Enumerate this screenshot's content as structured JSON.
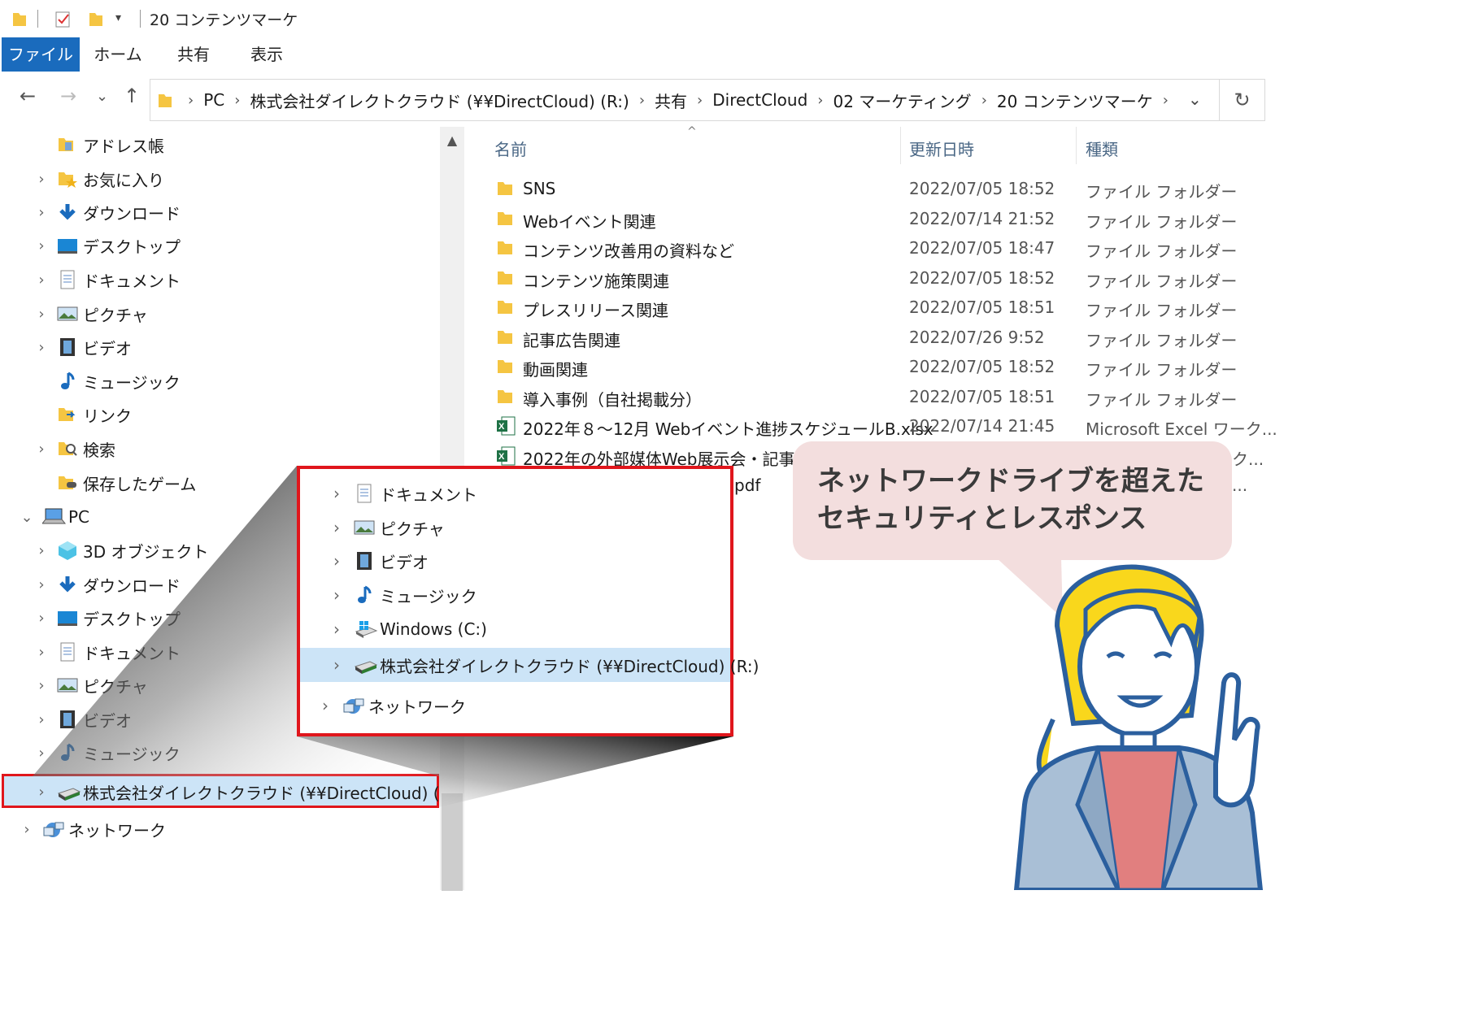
{
  "window": {
    "title": "20 コンテンツマーケ"
  },
  "ribbon": {
    "tabs": [
      {
        "label": "ファイル"
      },
      {
        "label": "ホーム"
      },
      {
        "label": "共有"
      },
      {
        "label": "表示"
      }
    ]
  },
  "address": {
    "crumbs": [
      "PC",
      "株式会社ダイレクトクラウド (¥¥DirectCloud) (R:)",
      "共有",
      "DirectCloud",
      "02 マーケティング",
      "20 コンテンツマーケ"
    ],
    "sep": "›"
  },
  "nav": {
    "items": [
      {
        "label": "アドレス帳",
        "icon": "contacts-folder-icon",
        "chev": ""
      },
      {
        "label": "お気に入り",
        "icon": "favorites-folder-icon",
        "chev": "›"
      },
      {
        "label": "ダウンロード",
        "icon": "download-icon",
        "chev": "›"
      },
      {
        "label": "デスクトップ",
        "icon": "desktop-icon",
        "chev": "›"
      },
      {
        "label": "ドキュメント",
        "icon": "document-icon",
        "chev": "›"
      },
      {
        "label": "ピクチャ",
        "icon": "picture-icon",
        "chev": "›"
      },
      {
        "label": "ビデオ",
        "icon": "video-icon",
        "chev": "›"
      },
      {
        "label": "ミュージック",
        "icon": "music-icon",
        "chev": ""
      },
      {
        "label": "リンク",
        "icon": "links-folder-icon",
        "chev": ""
      },
      {
        "label": "検索",
        "icon": "search-folder-icon",
        "chev": "›"
      },
      {
        "label": "保存したゲーム",
        "icon": "saved-games-icon",
        "chev": ""
      },
      {
        "label": "PC",
        "icon": "pc-icon",
        "chev": "⌄"
      },
      {
        "label": "3D オブジェクト",
        "icon": "3d-objects-icon",
        "chev": "›"
      },
      {
        "label": "ダウンロード",
        "icon": "download-icon",
        "chev": "›"
      },
      {
        "label": "デスクトップ",
        "icon": "desktop-icon",
        "chev": "›"
      },
      {
        "label": "ドキュメント",
        "icon": "document-icon",
        "chev": "›"
      },
      {
        "label": "ピクチャ",
        "icon": "picture-icon",
        "chev": "›"
      },
      {
        "label": "ビデオ",
        "icon": "video-icon",
        "chev": "›"
      },
      {
        "label": "ミュージック",
        "icon": "music-icon",
        "chev": "›"
      },
      {
        "label": "株式会社ダイレクトクラウド (¥¥DirectCloud) (R:)",
        "icon": "network-drive-icon",
        "chev": "›"
      },
      {
        "label": "ネットワーク",
        "icon": "network-icon",
        "chev": "›"
      }
    ]
  },
  "files": {
    "headers": {
      "name": "名前",
      "date": "更新日時",
      "type": "種類"
    },
    "rows": [
      {
        "name": "SNS",
        "date": "2022/07/05 18:52",
        "type": "ファイル フォルダー",
        "icon": "folder-icon"
      },
      {
        "name": "Webイベント関連",
        "date": "2022/07/14 21:52",
        "type": "ファイル フォルダー",
        "icon": "folder-icon"
      },
      {
        "name": "コンテンツ改善用の資料など",
        "date": "2022/07/05 18:47",
        "type": "ファイル フォルダー",
        "icon": "folder-icon"
      },
      {
        "name": "コンテンツ施策関連",
        "date": "2022/07/05 18:52",
        "type": "ファイル フォルダー",
        "icon": "folder-icon"
      },
      {
        "name": "プレスリリース関連",
        "date": "2022/07/05 18:51",
        "type": "ファイル フォルダー",
        "icon": "folder-icon"
      },
      {
        "name": "記事広告関連",
        "date": "2022/07/26 9:52",
        "type": "ファイル フォルダー",
        "icon": "folder-icon"
      },
      {
        "name": "動画関連",
        "date": "2022/07/05 18:52",
        "type": "ファイル フォルダー",
        "icon": "folder-icon"
      },
      {
        "name": "導入事例（自社掲載分）",
        "date": "2022/07/05 18:51",
        "type": "ファイル フォルダー",
        "icon": "folder-icon"
      },
      {
        "name": "2022年８～12月 Webイベント進捗スケジュールB.xlsx",
        "date": "2022/07/14 21:45",
        "type": "Microsoft Excel ワーク...",
        "icon": "excel-file-icon"
      },
      {
        "name": "2022年の外部媒体Web展示会・記事広",
        "date": "",
        "type": "ワーク...",
        "icon": "excel-file-icon"
      },
      {
        "name": "pdf",
        "date": "",
        "type": "...",
        "icon": "pdf-file-icon"
      }
    ]
  },
  "zoom": {
    "items": [
      {
        "label": "ドキュメント",
        "icon": "document-icon"
      },
      {
        "label": "ピクチャ",
        "icon": "picture-icon"
      },
      {
        "label": "ビデオ",
        "icon": "video-icon"
      },
      {
        "label": "ミュージック",
        "icon": "music-icon"
      },
      {
        "label": "Windows (C:)",
        "icon": "windows-drive-icon"
      },
      {
        "label": "株式会社ダイレクトクラウド (¥¥DirectCloud) (R:)",
        "icon": "network-drive-icon"
      },
      {
        "label": "ネットワーク",
        "icon": "network-icon"
      }
    ]
  },
  "callout": {
    "text": "ネットワークドライブを超えた\nセキュリティとレスポンス"
  },
  "colors": {
    "accent": "#1a6bbd",
    "highlight": "#cce4f7",
    "callout_border": "#e0161c",
    "speech_bg": "#f3dede",
    "folder": "#f5c542"
  }
}
